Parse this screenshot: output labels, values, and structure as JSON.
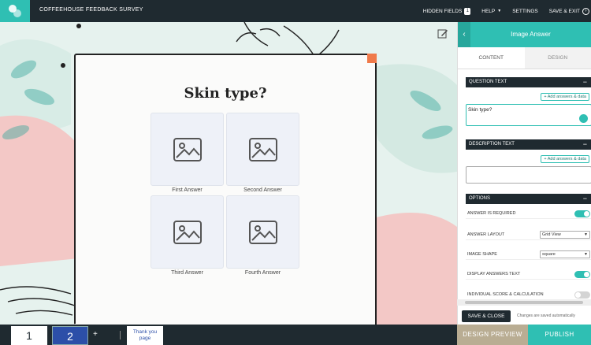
{
  "app": {
    "title": "COFFEEHOUSE FEEDBACK SURVEY"
  },
  "topnav": {
    "hidden_fields": "HIDDEN FIELDS",
    "hidden_fields_count": "1",
    "help": "HELP",
    "settings": "SETTINGS",
    "save_exit": "SAVE & EXIT"
  },
  "question": {
    "title": "Skin type?",
    "answers": [
      {
        "label": "First Answer"
      },
      {
        "label": "Second Answer"
      },
      {
        "label": "Third Answer"
      },
      {
        "label": "Fourth Answer"
      }
    ]
  },
  "panel": {
    "title": "Image Answer",
    "tabs": {
      "content": "CONTENT",
      "design": "DESIGN"
    },
    "question_text_header": "QUESTION TEXT",
    "add_answers_label": "+ Add answers & data",
    "question_text_value": "Skin type?",
    "description_text_header": "DESCRIPTION TEXT",
    "options_header": "OPTIONS",
    "options": {
      "answer_required": "ANSWER IS REQUIRED",
      "answer_layout": "ANSWER LAYOUT",
      "answer_layout_value": "Grid View",
      "image_shape": "IMAGE SHAPE",
      "image_shape_value": "square",
      "display_answers_text": "DISPLAY ANSWERS TEXT",
      "individual_score": "INDIVIDUAL SCORE & CALCULATION"
    },
    "save_close": "SAVE & CLOSE",
    "autosave_note": "Changes are saved automatically"
  },
  "bottom": {
    "page1": "1",
    "page2": "2",
    "add": "+",
    "thank_you": "Thank you page",
    "design_preview": "DESIGN PREVIEW",
    "publish": "PUBLISH"
  },
  "colors": {
    "accent": "#2fbfb3",
    "dark": "#1f2a30",
    "page_active": "#2c4fa8",
    "preview": "#b9ad93",
    "corner": "#f07a4a"
  }
}
